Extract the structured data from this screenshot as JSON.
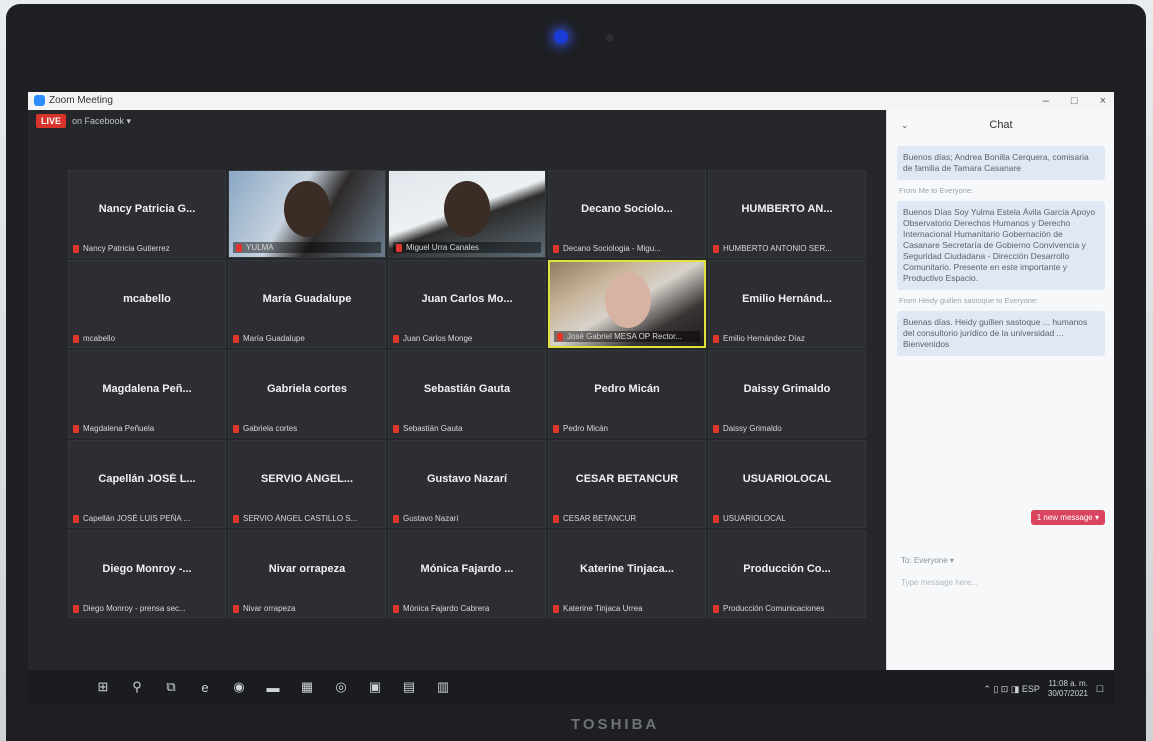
{
  "window": {
    "title": "Zoom Meeting",
    "minimize": "–",
    "maximize": "□",
    "close": "×"
  },
  "live": {
    "badge": "LIVE",
    "label": "on Facebook ▾"
  },
  "participants": [
    {
      "big": "Nancy Patricia G...",
      "small": "Nancy Patricia Gutierrez",
      "video": false
    },
    {
      "big": "",
      "small": "YULMA",
      "video": true
    },
    {
      "big": "",
      "small": "Miguel Urra Canales",
      "video": true
    },
    {
      "big": "Decano Sociolo...",
      "small": "Decano Sociologia - Migu...",
      "video": false
    },
    {
      "big": "HUMBERTO AN...",
      "small": "HUMBERTO ANTONIO SER...",
      "video": false
    },
    {
      "big": "mcabello",
      "small": "mcabello",
      "video": false
    },
    {
      "big": "María Guadalupe",
      "small": "María Guadalupe",
      "video": false
    },
    {
      "big": "Juan Carlos Mo...",
      "small": "Juan Carlos Monge",
      "video": false
    },
    {
      "big": "",
      "small": "José Gabriel MESA OP Rector...",
      "video": true
    },
    {
      "big": "Emilio Hernánd...",
      "small": "Emilio Hernández Díaz",
      "video": false
    },
    {
      "big": "Magdalena Peñ...",
      "small": "Magdalena Peñuela",
      "video": false
    },
    {
      "big": "Gabriela cortes",
      "small": "Gabriela cortes",
      "video": false
    },
    {
      "big": "Sebastián Gauta",
      "small": "Sebastián Gauta",
      "video": false
    },
    {
      "big": "Pedro Micán",
      "small": "Pedro Micán",
      "video": false
    },
    {
      "big": "Daissy Grimaldo",
      "small": "Daissy Grimaldo",
      "video": false
    },
    {
      "big": "Capellán JOSÉ L...",
      "small": "Capellán JOSÉ LUIS PEÑA ...",
      "video": false
    },
    {
      "big": "SERVIO ÁNGEL...",
      "small": "SERVIO ÁNGEL CASTILLO S...",
      "video": false
    },
    {
      "big": "Gustavo Nazarí",
      "small": "Gustavo Nazarí",
      "video": false
    },
    {
      "big": "CESAR BETANCUR",
      "small": "CESAR BETANCUR",
      "video": false
    },
    {
      "big": "USUARIOLOCAL",
      "small": "USUARIOLOCAL",
      "video": false
    },
    {
      "big": "Diego Monroy -...",
      "small": "Diego Monroy - prensa sec...",
      "video": false
    },
    {
      "big": "Nivar orrapeza",
      "small": "Nivar orrapeza",
      "video": false
    },
    {
      "big": "Mónica Fajardo ...",
      "small": "Mónica Fajardo Cabrera",
      "video": false
    },
    {
      "big": "Katerine Tinjaca...",
      "small": "Katerine Tinjaca Urrea",
      "video": false
    },
    {
      "big": "Producción Co...",
      "small": "Producción Comunicaciones",
      "video": false
    }
  ],
  "chat": {
    "title": "Chat",
    "collapse": "⌄",
    "messages": [
      {
        "from": "",
        "text": "Buenos días; Andrea Bonilla Cerquera, comisaria de familia de Tamara Casanare"
      },
      {
        "from": "From Me to Everyone:",
        "text": "Buenos Días Soy Yulma Estela Ávila García Apoyo Observatorio Derechos Humanos y Derecho Internacional Humanitario Gobernación de Casanare Secretaría de Gobierno Convivencia y Seguridad Ciudadana - Dirección Desarrollo Comunitario. Presente en este importante y Productivo Espacio."
      },
      {
        "from": "From Heidy guillen sastoque to Everyone:",
        "text": "Buenas días. Heidy guillen sastoque ... humanos del consultorio jurídico de la universidad ... Bienvenidos"
      }
    ],
    "new_message": "1 new message ▾",
    "to_label": "To: Everyone ▾",
    "compose_placeholder": "Type message here..."
  },
  "taskbar": {
    "items": [
      "⊞",
      "⚲",
      "⧉",
      "e",
      "◉",
      "▬",
      "▦",
      "◎",
      "▣",
      "▤",
      "▥"
    ],
    "tray_icons": "⌃ ▯ ⊡ ◨ ESP",
    "time": "11:08 a. m.",
    "date": "30/07/2021",
    "notify": "☐"
  },
  "laptop": {
    "brand": "TOSHIBA"
  }
}
